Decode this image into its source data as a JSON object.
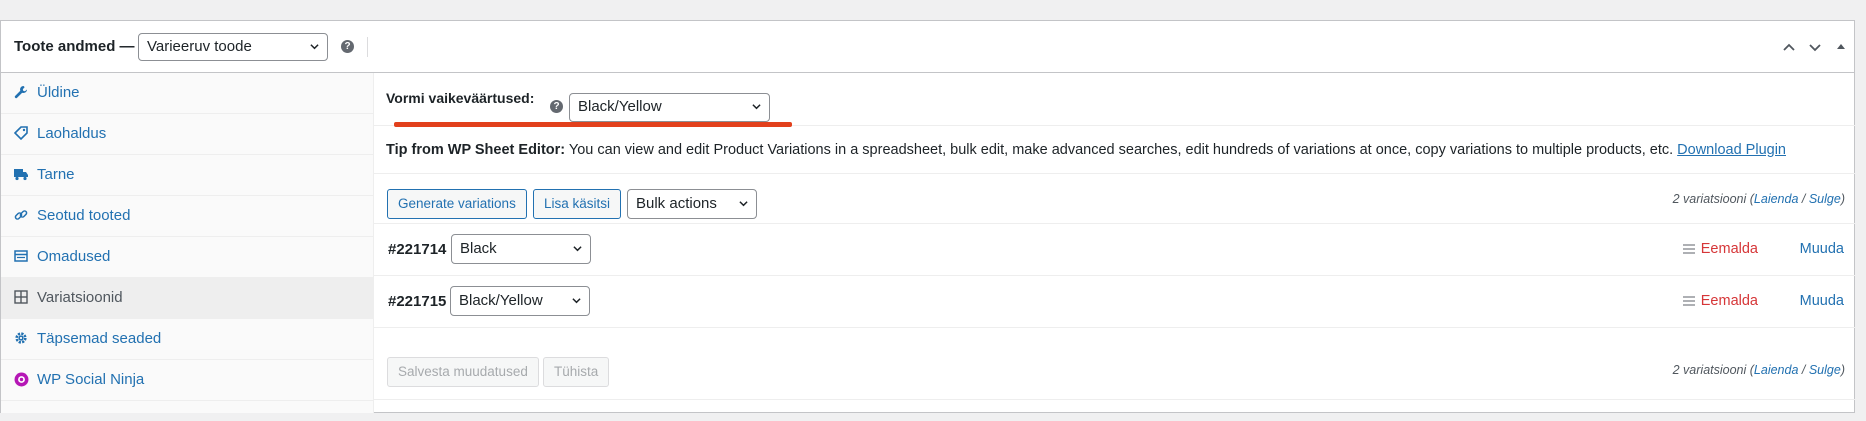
{
  "header": {
    "title": "Toote andmed —",
    "product_type": "Varieeruv toode",
    "help_icon": "question-icon"
  },
  "sidebar": {
    "items": [
      {
        "label": "Üldine",
        "icon": "wrench-icon"
      },
      {
        "label": "Laohaldus",
        "icon": "tag-icon"
      },
      {
        "label": "Tarne",
        "icon": "truck-icon"
      },
      {
        "label": "Seotud tooted",
        "icon": "link-icon"
      },
      {
        "label": "Omadused",
        "icon": "table-icon"
      },
      {
        "label": "Variatsioonid",
        "icon": "grid-icon",
        "active": true
      },
      {
        "label": "Täpsemad seaded",
        "icon": "gear-icon"
      },
      {
        "label": "WP Social Ninja",
        "icon": "ninja-icon"
      }
    ]
  },
  "defaults": {
    "label": "Vormi vaikeväärtused:",
    "value": "Black/Yellow",
    "accent_color": "#e2401c"
  },
  "tip": {
    "prefix": "Tip from WP Sheet Editor:",
    "text": " You can view and edit Product Variations in a spreadsheet, bulk edit, make advanced searches, edit hundreds of variations at once, copy variations to multiple products, etc. ",
    "link": "Download Plugin"
  },
  "toolbar": {
    "generate_label": "Generate variations",
    "add_manual_label": "Lisa käsitsi",
    "bulk_actions": "Bulk actions",
    "count_text": "2 variatsiooni",
    "expand_label": "Laienda",
    "separator": " / ",
    "collapse_label": "Sulge"
  },
  "variations": [
    {
      "id": "#221714",
      "value": "Black",
      "remove": "Eemalda",
      "edit": "Muuda"
    },
    {
      "id": "#221715",
      "value": "Black/Yellow",
      "remove": "Eemalda",
      "edit": "Muuda"
    }
  ],
  "footer": {
    "save_label": "Salvesta muudatused",
    "cancel_label": "Tühista",
    "count_text": "2 variatsiooni",
    "expand_label": "Laienda",
    "separator": " / ",
    "collapse_label": "Sulge"
  }
}
